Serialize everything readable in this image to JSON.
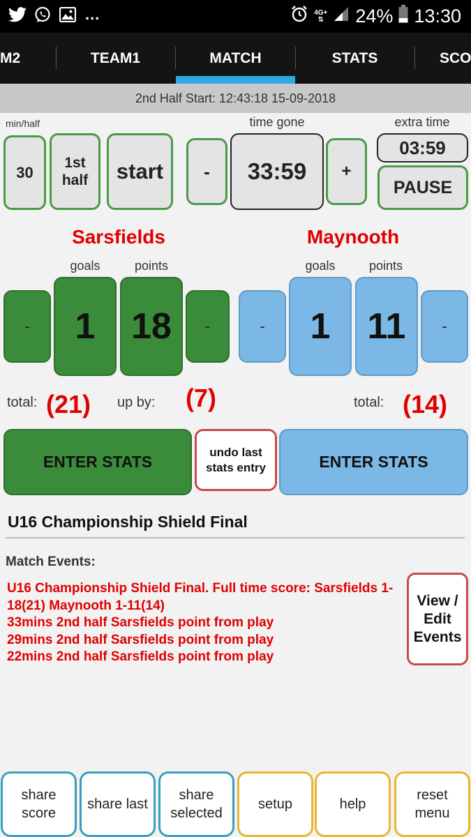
{
  "status_bar": {
    "icons": [
      "twitter-icon",
      "whatsapp-icon",
      "gallery-icon"
    ],
    "more": "...",
    "network": "4G+",
    "battery_pct": "24%",
    "time": "13:30"
  },
  "tabs": [
    {
      "label": "M2"
    },
    {
      "label": "TEAM1"
    },
    {
      "label": "MATCH",
      "active": true
    },
    {
      "label": "STATS"
    },
    {
      "label": "SCO"
    }
  ],
  "half_start": "2nd Half Start: 12:43:18   15-09-2018",
  "timer": {
    "min_half_label": "min/half",
    "min_half_value": "30",
    "half_label": "1st\nhalf",
    "start_label": "start",
    "time_gone_label": "time gone",
    "minus": "-",
    "time_gone": "33:59",
    "plus": "+",
    "extra_time_label": "extra time",
    "extra_time": "03:59",
    "pause_label": "PAUSE"
  },
  "home": {
    "name": "Sarsfields",
    "goals_label": "goals",
    "points_label": "points",
    "goals": "1",
    "points": "18",
    "minus": "-",
    "total_label": "total:",
    "total": "(21)",
    "enter_stats": "ENTER STATS"
  },
  "away": {
    "name": "Maynooth",
    "goals_label": "goals",
    "points_label": "points",
    "goals": "1",
    "points": "11",
    "minus": "-",
    "total_label": "total:",
    "total": "(14)",
    "enter_stats": "ENTER STATS"
  },
  "lead": {
    "label": "up by:",
    "value": "(7)"
  },
  "undo_label": "undo last\nstats entry",
  "match_title": "U16 Championship Shield Final",
  "events_label": "Match Events:",
  "events": [
    "U16 Championship Shield Final. Full time score: Sarsfields 1-18(21)  Maynooth 1-11(14)",
    "33mins 2nd half Sarsfields point from play",
    "29mins 2nd half Sarsfields point from play",
    "22mins 2nd half Sarsfields point from play"
  ],
  "view_edit_label": "View /\nEdit\nEvents",
  "bottom_buttons": [
    {
      "label": "share\nscore"
    },
    {
      "label": "share last"
    },
    {
      "label": "share\nselected"
    },
    {
      "label": "setup"
    },
    {
      "label": "help"
    },
    {
      "label": "reset\nmenu"
    }
  ],
  "colors": {
    "home": "#3a8c3a",
    "away": "#7bb8e5",
    "accent_red": "#e00000",
    "tab_indicator": "#2fa9e2"
  }
}
